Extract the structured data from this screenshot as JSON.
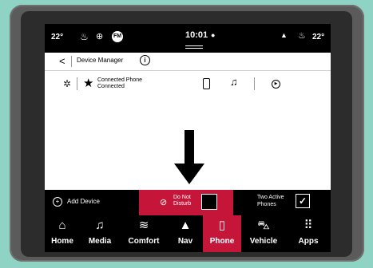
{
  "status_bar": {
    "temp_left": "22°",
    "radio_badge": "FM",
    "clock": "10:01",
    "temp_right": "22°"
  },
  "header": {
    "back_glyph": "<",
    "title": "Device Manager",
    "info_glyph": "i"
  },
  "device": {
    "name": "Connected Phone",
    "status": "Connected"
  },
  "actions": {
    "add_device": "Add Device",
    "dnd_line1": "Do Not",
    "dnd_line2": "Disturb",
    "dnd_checked": false,
    "two_phones_line1": "Two Active",
    "two_phones_line2": "Phones",
    "two_phones_checked": true,
    "check_glyph": "✓"
  },
  "nav": [
    {
      "label": "Home",
      "icon": "home-icon",
      "glyph": "⌂",
      "active": false
    },
    {
      "label": "Media",
      "icon": "music-note-icon",
      "glyph": "♫",
      "active": false
    },
    {
      "label": "Comfort",
      "icon": "comfort-icon",
      "glyph": "≋",
      "active": false
    },
    {
      "label": "Nav",
      "icon": "navigation-arrow-icon",
      "glyph": "▲",
      "active": false
    },
    {
      "label": "Phone",
      "icon": "phone-icon",
      "glyph": "▯",
      "active": true
    },
    {
      "label": "Vehicle",
      "icon": "car-icon",
      "glyph": "⛍",
      "active": false
    },
    {
      "label": "Apps",
      "icon": "apps-grid-icon",
      "glyph": "⠿",
      "active": false
    }
  ],
  "colors": {
    "accent": "#c5163a",
    "bar_bg": "#000000",
    "frame_bg": "#8fd3c4"
  }
}
